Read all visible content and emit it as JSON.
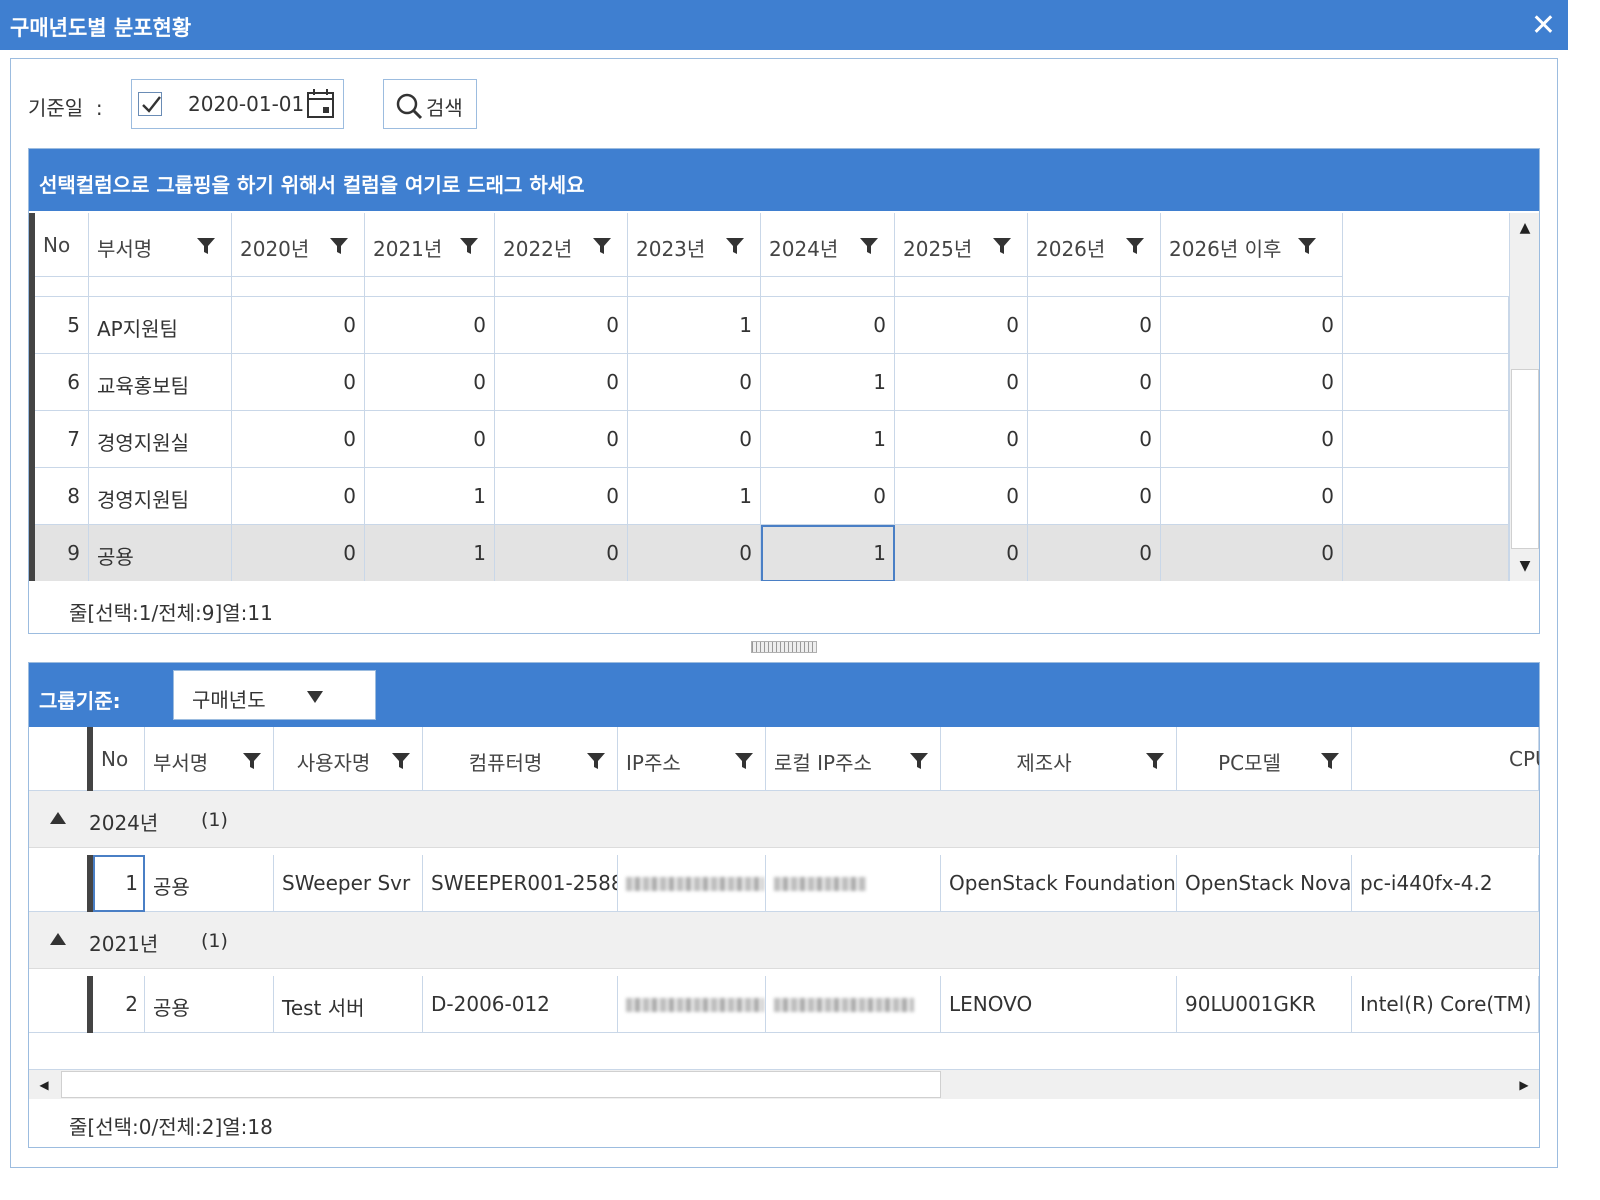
{
  "window": {
    "title": "구매년도별 분포현황",
    "close_label": "✕"
  },
  "filter": {
    "date_label": "기준일",
    "colon": ":",
    "date_checked": true,
    "date_value": "2020-01-01",
    "search_label": "검색"
  },
  "grid1": {
    "group_hint": "선택컬럼으로 그룹핑을 하기 위해서 컬럼을 여기로 드래그 하세요",
    "columns": [
      "No",
      "부서명",
      "2020년",
      "2021년",
      "2022년",
      "2023년",
      "2024년",
      "2025년",
      "2026년",
      "2026년 이후"
    ],
    "rows": [
      {
        "no": "5",
        "dept": "AP지원팀",
        "vals": [
          "0",
          "0",
          "0",
          "1",
          "0",
          "0",
          "0",
          "0"
        ]
      },
      {
        "no": "6",
        "dept": "교육홍보팀",
        "vals": [
          "0",
          "0",
          "0",
          "0",
          "1",
          "0",
          "0",
          "0"
        ]
      },
      {
        "no": "7",
        "dept": "경영지원실",
        "vals": [
          "0",
          "0",
          "0",
          "0",
          "1",
          "0",
          "0",
          "0"
        ]
      },
      {
        "no": "8",
        "dept": "경영지원팀",
        "vals": [
          "0",
          "1",
          "0",
          "1",
          "0",
          "0",
          "0",
          "0"
        ]
      },
      {
        "no": "9",
        "dept": "공용",
        "vals": [
          "0",
          "1",
          "0",
          "0",
          "1",
          "0",
          "0",
          "0"
        ]
      }
    ],
    "status": "줄[선택:1/전체:9]열:11"
  },
  "grid2": {
    "group_label": "그룹기준:",
    "group_value": "구매년도",
    "columns": [
      "No",
      "부서명",
      "사용자명",
      "컴퓨터명",
      "IP주소",
      "로컬 IP주소",
      "제조사",
      "PC모델",
      "CPU"
    ],
    "groups": [
      {
        "label": "2024년",
        "count": "(1)",
        "rows": [
          {
            "no": "1",
            "dept": "공용",
            "user": "SWeeper Svr",
            "computer": "SWEEPER001-2588",
            "maker": "OpenStack Foundation",
            "model": "OpenStack Nova",
            "cpu": "pc-i440fx-4.2"
          }
        ]
      },
      {
        "label": "2021년",
        "count": "(1)",
        "rows": [
          {
            "no": "2",
            "dept": "공용",
            "user": "Test 서버",
            "computer": "D-2006-012",
            "maker": "LENOVO",
            "model": "90LU001GKR",
            "cpu": "Intel(R) Core(TM) i"
          }
        ]
      }
    ],
    "status": "줄[선택:0/전체:2]열:18"
  }
}
